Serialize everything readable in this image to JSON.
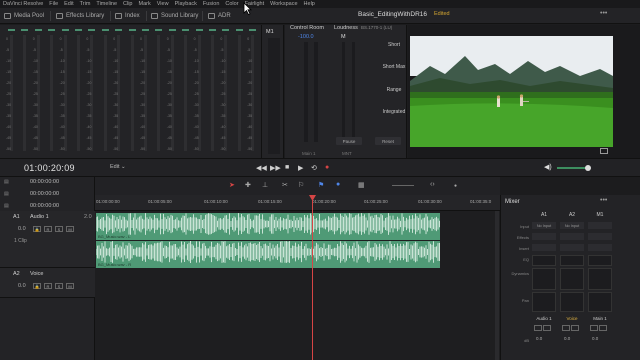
{
  "menubar": {
    "items": [
      "DaVinci Resolve",
      "File",
      "Edit",
      "Trim",
      "Timeline",
      "Clip",
      "Mark",
      "View",
      "Playback",
      "Fusion",
      "Color",
      "Fairlight",
      "Workspace",
      "Help"
    ]
  },
  "toolbar": {
    "media_pool": "Media Pool",
    "effects_library": "Effects Library",
    "index": "Index",
    "sound_library": "Sound Library",
    "adr": "ADR",
    "project_title": "Basic_EditingWithDR16",
    "project_status": "Edited",
    "more": "•••"
  },
  "meters": {
    "ticks": [
      "0",
      "-5",
      "-10",
      "-15",
      "-20",
      "-25",
      "-30",
      "-35",
      "-40",
      "-45",
      "-50"
    ],
    "m1_label": "M1"
  },
  "control_room": {
    "title": "Control Room",
    "value": "-100.0",
    "m_label": "M",
    "footer_left": "Main 1",
    "footer_right": "MNT"
  },
  "loudness": {
    "title": "Loudness",
    "subtitle": "BS.1770-1 (LU)",
    "short": "Short",
    "short_max": "Short Max",
    "range": "Range",
    "integrated": "Integrated",
    "pause": "Pause",
    "reset": "Reset"
  },
  "transport": {
    "timecode": "01:00:20:09",
    "edit_mode": "Edit",
    "controls": [
      "◀◀",
      "▶▶",
      "■",
      "▶",
      "⟲",
      "●"
    ]
  },
  "timeline": {
    "timecodes": [
      "00:00:00:00",
      "00:00:00:00",
      "00:00:00:00"
    ],
    "ruler": [
      "01:00:00:00",
      "01:00:05:00",
      "01:00:10:00",
      "01:00:15:00",
      "01:00:20:00",
      "01:00:25:00",
      "01:00:30:00",
      "01:00:35:0"
    ],
    "tracks": [
      {
        "id": "A1",
        "name": "Audio 1",
        "format": "2.0",
        "volume": "0.0",
        "clips_info": "1 Clip",
        "buttons": [
          "R",
          "S",
          "M"
        ]
      },
      {
        "id": "A2",
        "name": "Voice",
        "format": "",
        "volume": "0.0",
        "clips_info": "",
        "buttons": [
          "R",
          "S",
          "M"
        ]
      }
    ],
    "clips": [
      {
        "label": "BG_Music.wav - L"
      },
      {
        "label": "BG_Music.wav - R"
      }
    ]
  },
  "mixer": {
    "title": "Mixer",
    "more": "•••",
    "channels": [
      "A1",
      "A2",
      "M1"
    ],
    "rows": [
      "Input",
      "Effects",
      "Insert",
      "EQ",
      "Dynamics",
      "Pan",
      "dB"
    ],
    "input_values": [
      "No Input",
      "No Input",
      ""
    ],
    "channel_names": [
      "Audio 1",
      "Voice",
      "Main 1"
    ],
    "channel_volumes": [
      "0.0",
      "0.0",
      "0.0"
    ],
    "accent_color": "#e0b341"
  },
  "colors": {
    "clip": "#4f9a76",
    "playhead": "#d64545",
    "accent_blue": "#4f86e8"
  }
}
